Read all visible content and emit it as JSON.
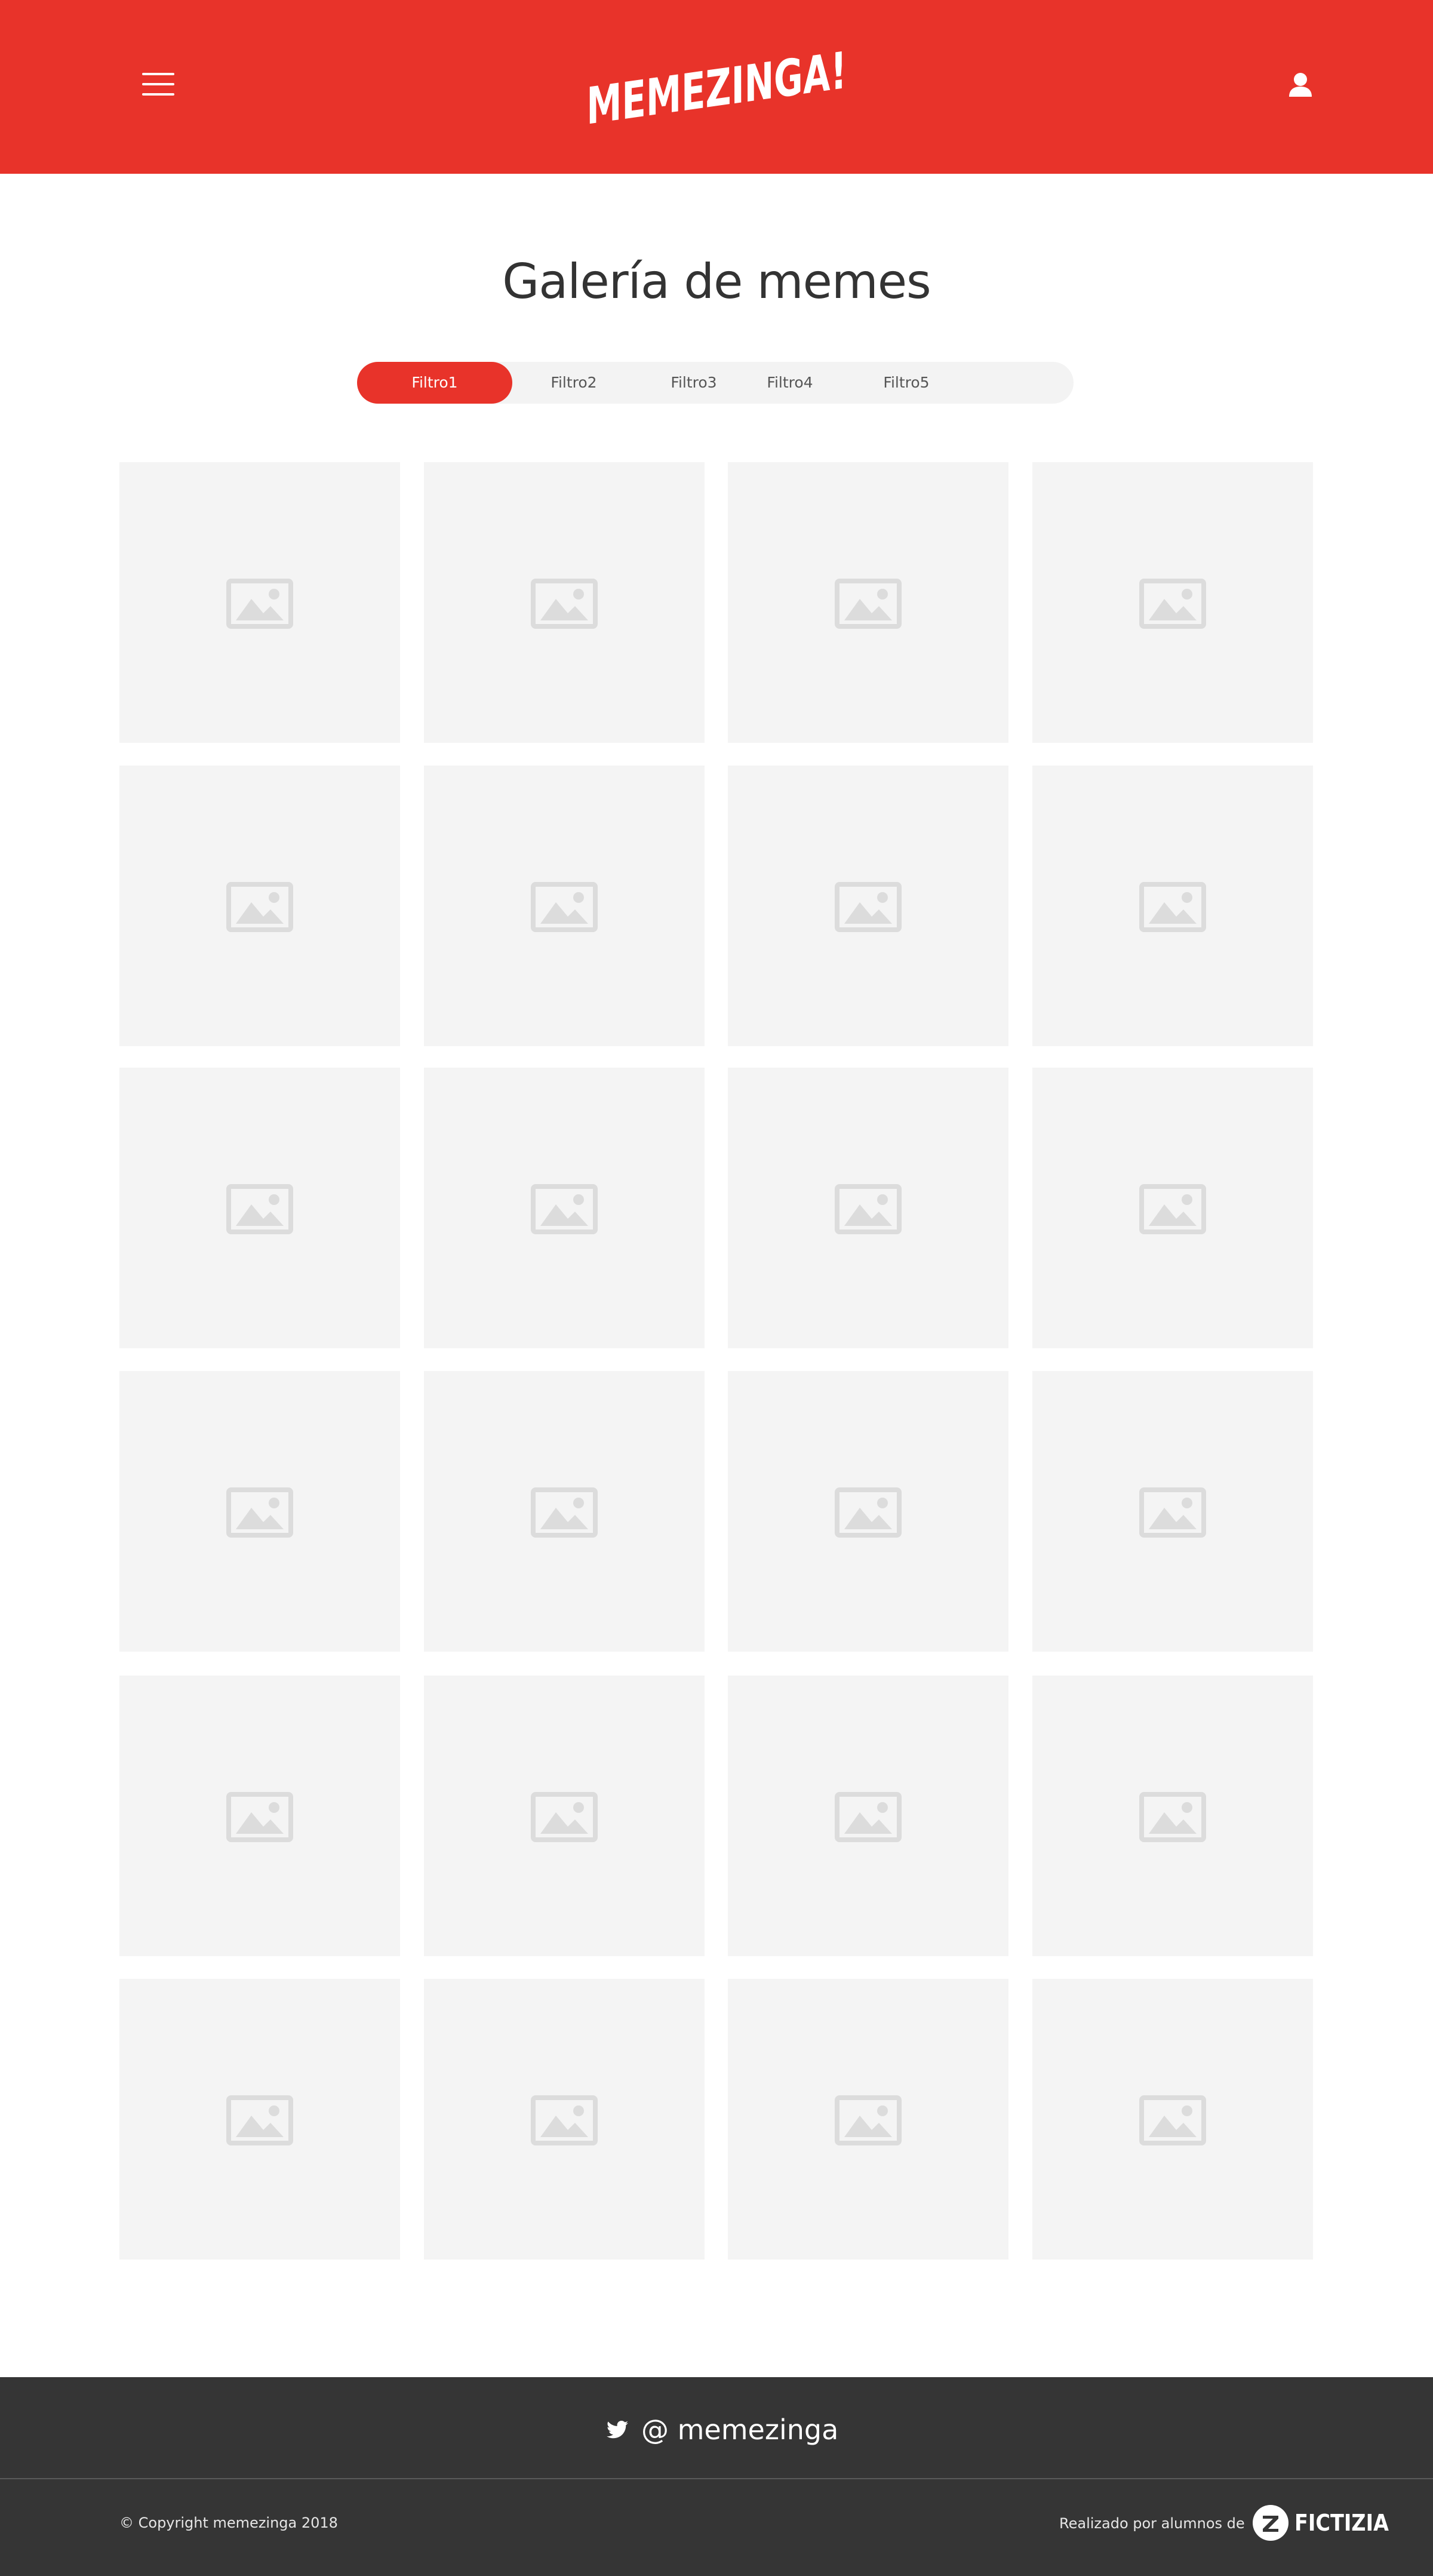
{
  "header": {
    "brand_logo": "MEMEZINGA!",
    "menu_icon": "hamburger-menu-icon",
    "user_icon": "user-icon",
    "background_color": "#e8332a"
  },
  "main": {
    "title": "Galería de memes",
    "filters": [
      {
        "label": "Filtro1",
        "active": true
      },
      {
        "label": "Filtro2",
        "active": false
      },
      {
        "label": "Filtro3",
        "active": false
      },
      {
        "label": "Filtro4",
        "active": false
      },
      {
        "label": "Filtro5",
        "active": false
      }
    ],
    "gallery": {
      "rows": 6,
      "columns": 4,
      "item_icon": "image-placeholder-icon"
    },
    "accent_color": "#e8332a"
  },
  "footer": {
    "twitter_icon": "twitter-icon",
    "twitter_handle": "@ memezinga",
    "copyright": "© Copyright memezinga  2018",
    "credits_text": "Realizado por alumnos de",
    "school_logo": "FICTIZIA",
    "background_color": "#353535"
  }
}
